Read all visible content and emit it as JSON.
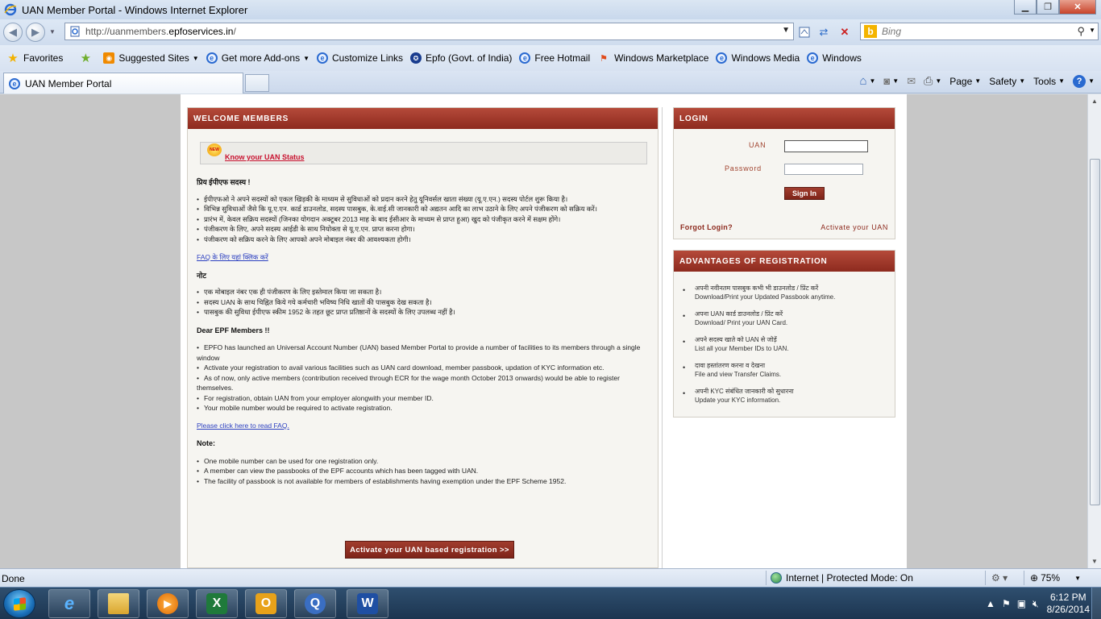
{
  "window": {
    "title": "UAN Member Portal - Windows Internet Explorer"
  },
  "address": {
    "url_prefix": "http://uanmembers.",
    "url_domain": "epfoservices.in",
    "url_suffix": "/"
  },
  "search": {
    "placeholder": "Bing"
  },
  "favorites_bar": {
    "favorites_label": "Favorites",
    "items": [
      "Suggested Sites",
      "Get more Add-ons",
      "Customize Links",
      "Epfo (Govt. of India)",
      "Free Hotmail",
      "Windows Marketplace",
      "Windows Media",
      "Windows"
    ]
  },
  "tab": {
    "label": "UAN Member Portal"
  },
  "command_bar": {
    "page": "Page",
    "safety": "Safety",
    "tools": "Tools",
    "help": "?"
  },
  "welcome": {
    "heading": "WELCOME MEMBERS",
    "new_badge": "NEW",
    "status_link": "Know your UAN Status",
    "hindi_greeting": "प्रिय ईपीएफ सदस्य !",
    "hindi_points": [
      "ईपीएफओ ने अपने सदस्यों को एकल खिड़की के माध्यम से सुविधाओं को प्रदान करने हेतु यूनिवर्सल खाता संख्या (यू.ए.एन.) सदस्य पोर्टल शुरू किया है।",
      "विभिन्न सुविधाओं जैसे कि यू.ए.एन. कार्ड डाउनलोड, सदस्य पासबुक, के.वाई.सी जानकारी को अद्यतन आदि का लाभ उठाने के लिए अपने पंजीकरण को सक्रिय करें।",
      "प्रारंभ में, केवल सक्रिय सदस्यों (जिनका योगदान अक्टूबर 2013 माह के बाद ईसीआर के माध्यम से प्राप्त हुआ) खुद को पंजीकृत करने में सक्षम होंगे।",
      "पंजीकरण के लिए, अपने सदस्य आईडी के साथ नियोक्ता से यू.ए.एन. प्राप्त करना होगा।",
      "पंजीकरण को सक्रिय करने के लिए आपको अपने मोबाइल नंबर की आवश्यकता होगी।"
    ],
    "hindi_faq_link": "FAQ के लिए यहां क्लिक करें",
    "hindi_note_heading": "नोट",
    "hindi_notes": [
      "एक मोबाइल नंबर एक ही पंजीकरण के लिए इस्तेमाल किया जा सकता है।",
      "सदस्य UAN के साथ चिह्नित किये गये कर्मचारी भविष्य निधि खातों की पासबुक देख सकता है।",
      "पासबुक की सुविधा ईपीएफ स्कीम 1952 के तहत छूट प्राप्त प्रतिष्ठानों के सदस्यों के लिए उपलब्ध नहीं है।"
    ],
    "english_greeting": "Dear EPF Members !!",
    "english_points": [
      "EPFO has launched an Universal Account Number (UAN) based Member Portal to provide a number of facilities to its members through a single window",
      "Activate your registration to avail various facilities such as UAN card download, member passbook, updation of KYC information etc.",
      "As of now, only active members (contribution received through ECR for the wage month October 2013 onwards) would be able to register themselves.",
      "For registration, obtain UAN from your employer alongwith your member ID.",
      "Your mobile number would be required to activate registration."
    ],
    "english_faq_link": "Please click here to read FAQ.",
    "note_heading": "Note:",
    "notes": [
      "One mobile number can be used for one registration only.",
      "A member can view the passbooks of the EPF accounts which has been tagged with UAN.",
      "The facility of passbook is not available for members of establishments having exemption under the EPF Scheme 1952."
    ],
    "activate_button": "Activate your UAN based registration >>"
  },
  "login": {
    "heading": "LOGIN",
    "uan_label": "UAN",
    "password_label": "Password",
    "signin": "Sign In",
    "forgot": "Forgot Login?",
    "activate": "Activate your UAN"
  },
  "advantages": {
    "heading": "ADVANTAGES OF REGISTRATION",
    "items": [
      {
        "hi": "अपनी नवीनतम पासबुक कभी भी डाउनलोड / प्रिंट करें",
        "en": "Download/Print your Updated Passbook anytime."
      },
      {
        "hi": "अपना UAN कार्ड डाउनलोड / प्रिंट करें",
        "en": "Download/ Print your UAN Card."
      },
      {
        "hi": "अपने सदस्य खाते को UAN से जोड़ें",
        "en": "List all your Member IDs to UAN."
      },
      {
        "hi": "दावा हस्तांतरण करना व देखना",
        "en": "File and view Transfer Claims."
      },
      {
        "hi": "अपनी KYC संबंधित जानकारी को सुधारना",
        "en": "Update your KYC information."
      }
    ]
  },
  "statusbar": {
    "left": "Done",
    "zone": "Internet | Protected Mode: On",
    "zoom": "75%"
  },
  "taskbar": {
    "time": "6:12 PM",
    "date": "8/26/2014"
  }
}
